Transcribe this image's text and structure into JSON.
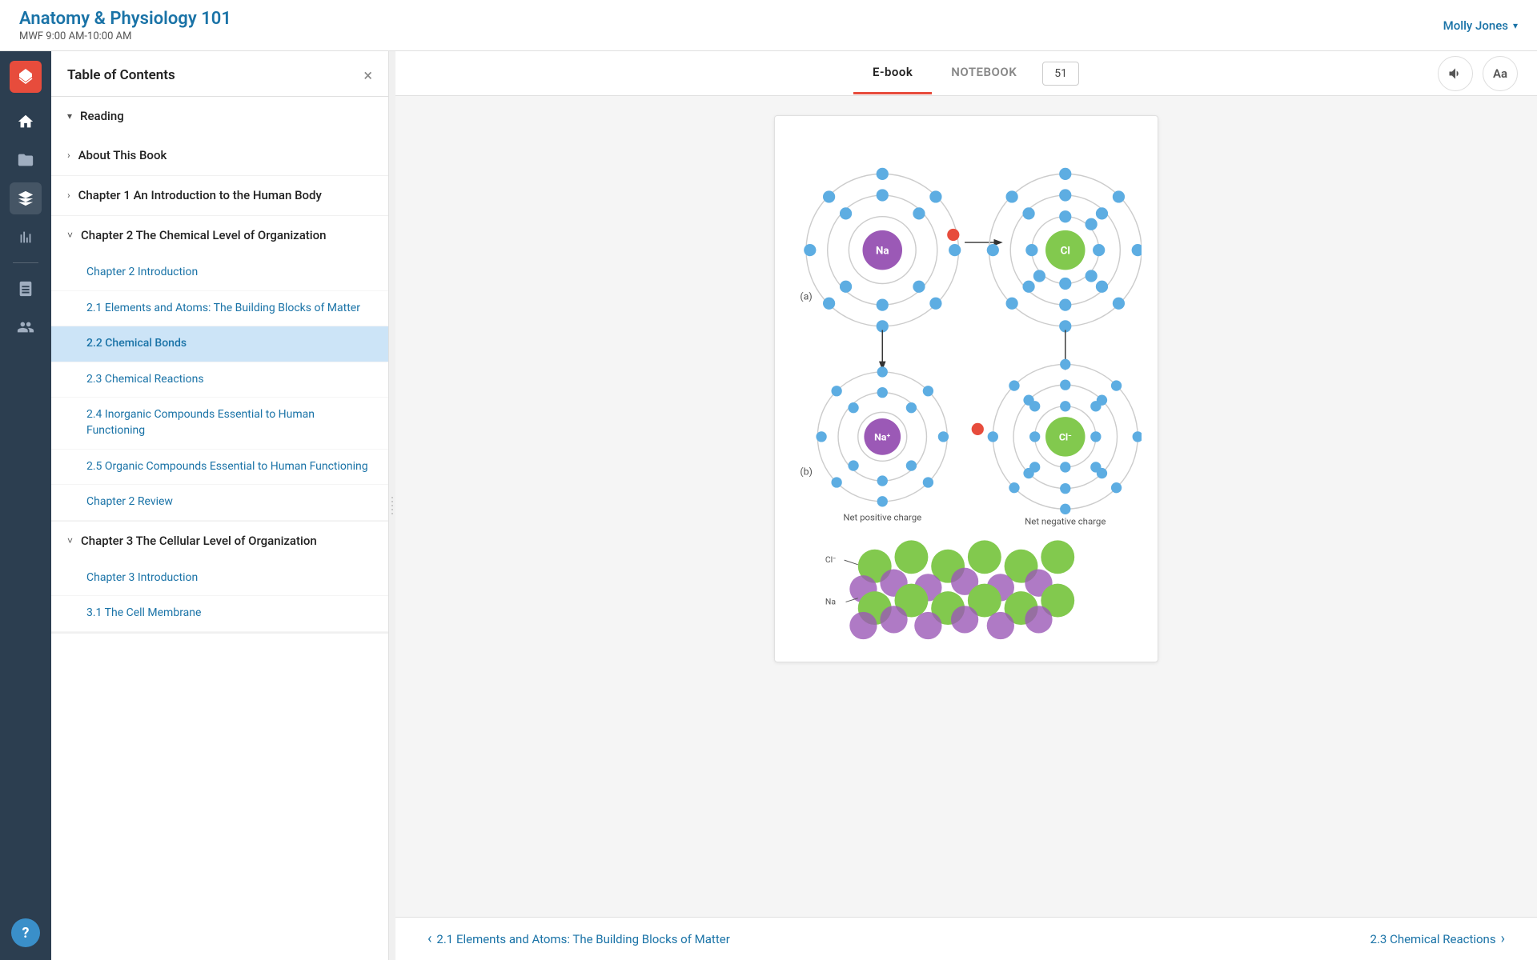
{
  "app": {
    "logo_icon": "mountain-icon",
    "course_title": "Anatomy & Physiology 101",
    "course_time": "MWF 9:00 AM-10:00 AM"
  },
  "user": {
    "name": "Molly Jones",
    "chevron": "▾"
  },
  "sidebar_icons": [
    {
      "name": "home-icon",
      "label": "Home",
      "active": false
    },
    {
      "name": "folder-icon",
      "label": "Folder",
      "active": false
    },
    {
      "name": "layers-icon",
      "label": "Layers",
      "active": true
    },
    {
      "name": "chart-icon",
      "label": "Chart",
      "active": false
    },
    {
      "name": "notebook-icon",
      "label": "Notebook",
      "active": false
    },
    {
      "name": "people-icon",
      "label": "People",
      "active": false
    }
  ],
  "toc": {
    "title": "Table of Contents",
    "close_label": "×",
    "sections": [
      {
        "id": "reading",
        "label": "Reading",
        "expanded": true,
        "chevron": "▾",
        "children": [
          {
            "id": "about-this-book",
            "label": "About This Book",
            "type": "section-header",
            "chevron": "›",
            "children": []
          },
          {
            "id": "chapter-1",
            "label": "Chapter 1 An Introduction to the Human Body",
            "type": "section-header",
            "chevron": "›",
            "children": []
          },
          {
            "id": "chapter-2",
            "label": "Chapter 2 The Chemical Level of Organization",
            "type": "section-header",
            "chevron": "˅",
            "expanded": true,
            "children": [
              {
                "id": "ch2-intro",
                "label": "Chapter 2 Introduction",
                "active": false
              },
              {
                "id": "ch2-1",
                "label": "2.1 Elements and Atoms: The Building Blocks of Matter",
                "active": false
              },
              {
                "id": "ch2-2",
                "label": "2.2 Chemical Bonds",
                "active": true
              },
              {
                "id": "ch2-3",
                "label": "2.3 Chemical Reactions",
                "active": false
              },
              {
                "id": "ch2-4",
                "label": "2.4 Inorganic Compounds Essential to Human Functioning",
                "active": false
              },
              {
                "id": "ch2-5",
                "label": "2.5 Organic Compounds Essential to Human Functioning",
                "active": false
              },
              {
                "id": "ch2-review",
                "label": "Chapter 2 Review",
                "active": false
              }
            ]
          },
          {
            "id": "chapter-3",
            "label": "Chapter 3 The Cellular Level of Organization",
            "type": "section-header",
            "chevron": "˅",
            "expanded": true,
            "children": [
              {
                "id": "ch3-intro",
                "label": "Chapter 3 Introduction",
                "active": false
              },
              {
                "id": "ch3-1",
                "label": "3.1 The Cell Membrane",
                "active": false
              }
            ]
          }
        ]
      }
    ]
  },
  "tabs": {
    "items": [
      {
        "id": "ebook",
        "label": "E-book",
        "active": true
      },
      {
        "id": "notebook",
        "label": "NOTEBOOK",
        "active": false
      }
    ],
    "count": "51"
  },
  "controls": {
    "audio_label": "🔊",
    "font_label": "Aa"
  },
  "bottom_nav": {
    "prev_label": "2.1 Elements and Atoms: The Building Blocks of Matter",
    "next_label": "2.3 Chemical Reactions",
    "prev_arrow": "‹",
    "next_arrow": "›"
  },
  "diagram": {
    "label_a": "(a)",
    "label_b": "(b)",
    "net_positive": "Net positive charge",
    "net_negative": "Net negative charge",
    "na_label": "Na",
    "cl_label": "Cl",
    "na_ion_label": "Na⁺",
    "cl_ion_label": "Cl⁻",
    "cl_crystal_label": "Cl⁻",
    "na_crystal_label": "Na"
  }
}
